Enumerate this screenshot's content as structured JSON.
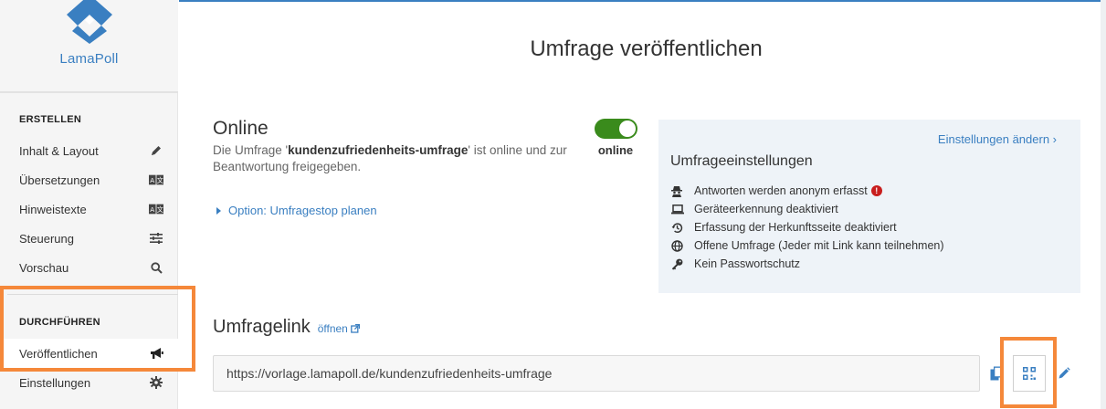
{
  "brand": {
    "name": "LamaPoll",
    "color": "#3a7fc1"
  },
  "sidebar": {
    "sections": [
      {
        "title": "ERSTELLEN",
        "items": [
          {
            "label": "Inhalt & Layout",
            "icon": "pencil-icon"
          },
          {
            "label": "Übersetzungen",
            "icon": "translate-icon"
          },
          {
            "label": "Hinweistexte",
            "icon": "translate-icon"
          },
          {
            "label": "Steuerung",
            "icon": "sliders-icon"
          },
          {
            "label": "Vorschau",
            "icon": "search-icon"
          }
        ]
      },
      {
        "title": "DURCHFÜHREN",
        "items": [
          {
            "label": "Veröffentlichen",
            "icon": "megaphone-icon",
            "active": true
          },
          {
            "label": "Einstellungen",
            "icon": "gear-icon"
          }
        ]
      }
    ]
  },
  "main": {
    "title": "Umfrage veröffentlichen",
    "online": {
      "heading": "Online",
      "desc_prefix": "Die Umfrage '",
      "survey_name": "kundenzufriedenheits-umfrage",
      "desc_suffix": "' ist online und zur Beantwortung freigegeben.",
      "toggle_label": "online",
      "toggle_on": true,
      "toggle_color": "#3a8b1c"
    },
    "option_link": "Option: Umfragestop planen",
    "settings": {
      "change_link": "Einstellungen ändern ›",
      "title": "Umfrageeinstellungen",
      "items": [
        {
          "text": "Antworten werden anonym erfasst",
          "icon": "anonymous-icon",
          "warning": true
        },
        {
          "text": "Geräteerkennung deaktiviert",
          "icon": "laptop-icon"
        },
        {
          "text": "Erfassung der Herkunftsseite deaktiviert",
          "icon": "history-icon"
        },
        {
          "text": "Offene Umfrage (Jeder mit Link kann teilnehmen)",
          "icon": "globe-icon"
        },
        {
          "text": "Kein Passwortschutz",
          "icon": "key-icon"
        }
      ],
      "warning_color": "#c81e1e"
    },
    "survey_link": {
      "heading": "Umfragelink",
      "open_label": "öffnen",
      "url": "https://vorlage.lamapoll.de/kundenzufriedenheits-umfrage"
    }
  },
  "highlight_color": "#f5883a"
}
